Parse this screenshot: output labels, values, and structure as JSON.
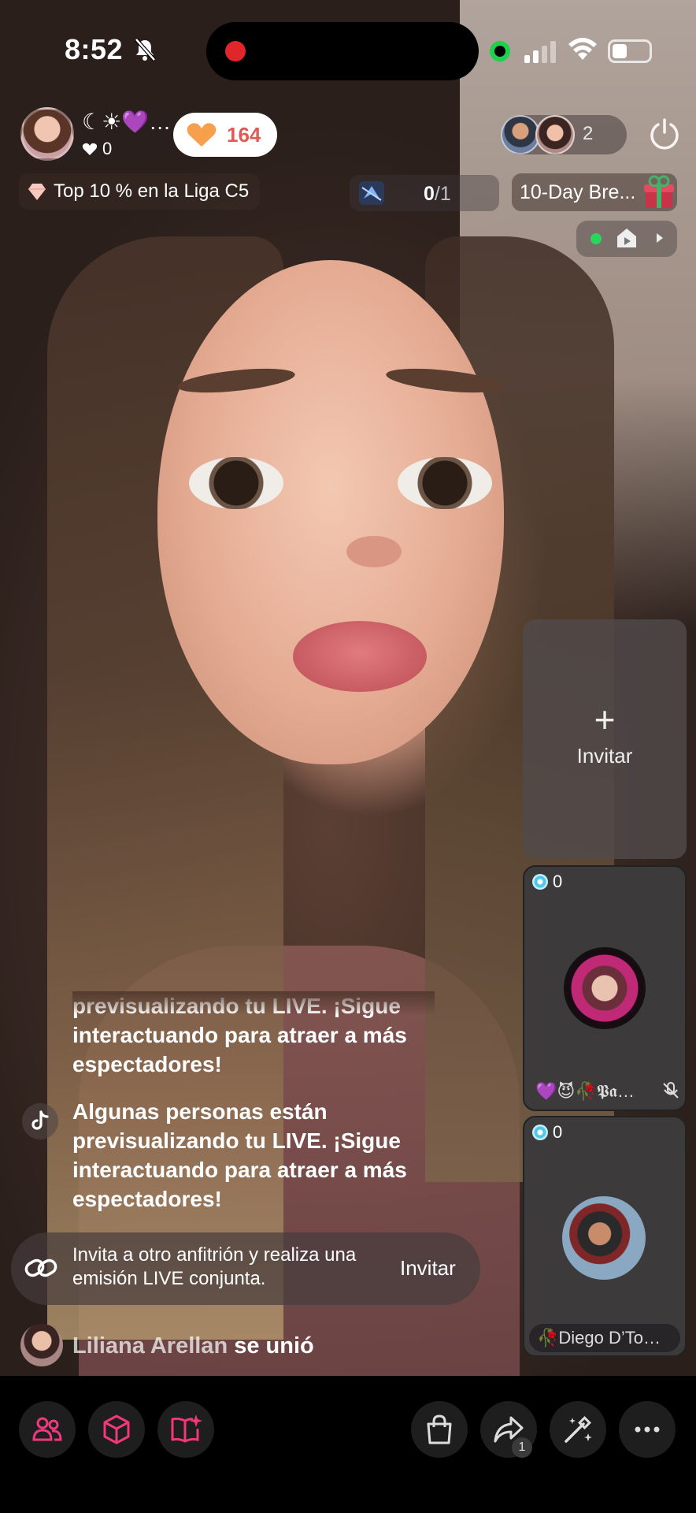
{
  "status_bar": {
    "time": "8:52",
    "colors": {
      "recording": "#e0262a",
      "camera_indicator": "#1fcf4e"
    }
  },
  "host": {
    "name": "☾☀💜…",
    "likes": "0",
    "coins": "164"
  },
  "viewers": {
    "count": "2"
  },
  "league": {
    "label": "Top 10 % en la Liga C5"
  },
  "mission": {
    "current": "0",
    "total": "/1"
  },
  "event": {
    "label": "10-Day Bre..."
  },
  "invite_panel": {
    "plus": "+",
    "label": "Invitar"
  },
  "guests": [
    {
      "score": "0",
      "name": "💜😈🥀𝕻𝖆…"
    },
    {
      "score": "0",
      "name": "🥀Diego D’To…"
    }
  ],
  "chat": {
    "faded_message": "previsualizando tu LIVE. ¡Sigue interactuando para atraer a más espectadores!",
    "system_message": "Algunas personas están previsualizando tu LIVE. ¡Sigue interactuando para atraer a más espectadores!",
    "invite_prompt": "Invita a otro anfitrión y realiza una emisión LIVE conjunta.",
    "invite_button": "Invitar",
    "join_user": "Liliana Arellan",
    "join_action": " se unió"
  },
  "bottom_bar": {
    "share_badge": "1",
    "icons": [
      "people-icon",
      "box-icon",
      "book-icon",
      "shopping-bag-icon",
      "share-icon",
      "magic-wand-icon",
      "more-icon"
    ],
    "accent_color": "#f0387a"
  }
}
